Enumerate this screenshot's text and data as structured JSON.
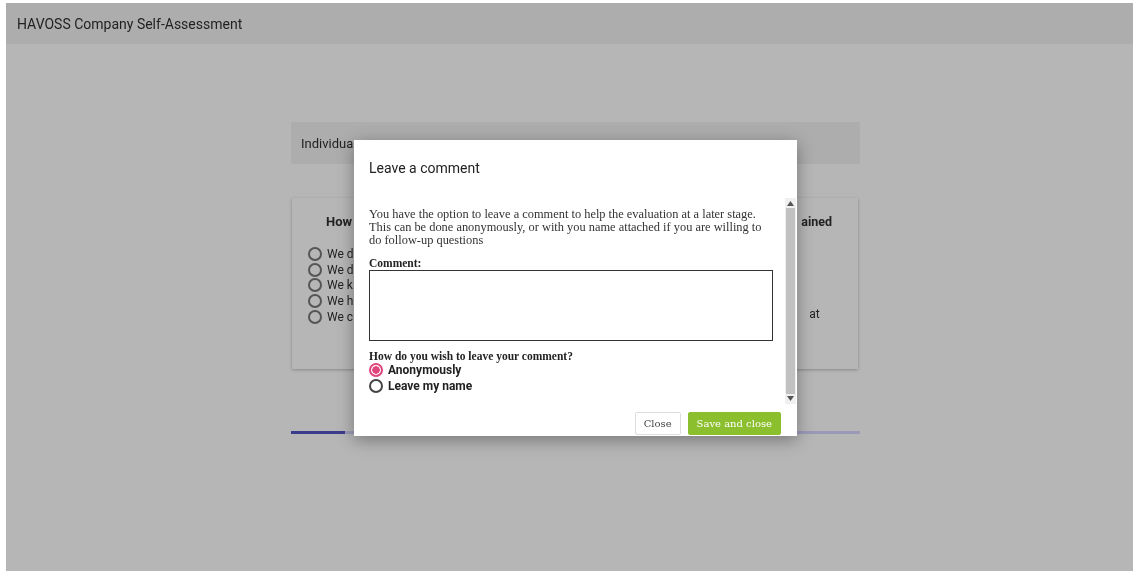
{
  "header": {
    "title": "HAVOSS Company Self-Assessment"
  },
  "background": {
    "section_title": "Individua",
    "card": {
      "question_left": "How",
      "question_right": "ained",
      "options": [
        {
          "label": "We d",
          "selected": false
        },
        {
          "label": "We d",
          "selected": false
        },
        {
          "label": "We k",
          "selected": false
        },
        {
          "label": "We h",
          "selected": false
        },
        {
          "label": "We c",
          "selected": false,
          "tail": "at"
        }
      ]
    },
    "progress": {
      "level": 0.095
    }
  },
  "dialog": {
    "title": "Leave a comment",
    "intro": "You have the option to leave a comment to help the evaluation at a later stage. This can be done anonymously, or with you name attached if you are willing to do follow-up questions",
    "comment_label": "Comment:",
    "question": "How do you wish to leave your comment?",
    "options": [
      {
        "label": "Anonymously",
        "selected": true
      },
      {
        "label": "Leave my name",
        "selected": false
      }
    ],
    "buttons": [
      {
        "label": "Close",
        "kind": "plain"
      },
      {
        "label": "Save and close",
        "kind": "primary"
      }
    ]
  }
}
